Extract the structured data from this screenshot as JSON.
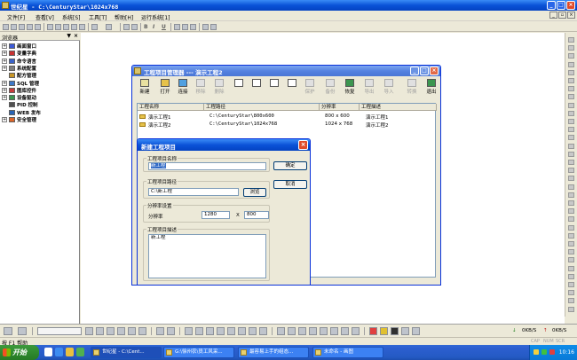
{
  "app": {
    "title": "世纪星 - C:\\CenturyStar\\1024x768"
  },
  "menu": [
    "文件[F]",
    "查看[V]",
    "系统[S]",
    "工具[T]",
    "帮助[H]",
    "运行系统[1]"
  ],
  "toolbar": {
    "font_b": "B",
    "font_i": "I",
    "font_u": "U"
  },
  "browser": {
    "title": "浏览器",
    "pin": "▼",
    "close": "×",
    "items": [
      {
        "expander": "+",
        "label": "画面窗口",
        "color": "#3c5ad8"
      },
      {
        "expander": "+",
        "label": "变量字典",
        "color": "#c83232"
      },
      {
        "expander": "+",
        "label": "命令语言",
        "color": "#3c64c8"
      },
      {
        "expander": "+",
        "label": "系统配置",
        "color": "#808080"
      },
      {
        "expander": "",
        "label": "配方管理",
        "color": "#c89628"
      },
      {
        "expander": "+",
        "label": "SQL 管理",
        "color": "#3c78c8"
      },
      {
        "expander": "+",
        "label": "图库控件",
        "color": "#c83c3c"
      },
      {
        "expander": "+",
        "label": "设备驱动",
        "color": "#3c9650"
      },
      {
        "expander": "",
        "label": "PID 控制",
        "color": "#505050"
      },
      {
        "expander": "",
        "label": "WEB 发布",
        "color": "#2864b4"
      },
      {
        "expander": "+",
        "label": "安全管理",
        "color": "#dc6428"
      }
    ]
  },
  "project_manager": {
    "title": "工程项目管理器 --- 演示工程2",
    "tools": [
      {
        "label": "新建",
        "enabled": true,
        "color": "#e8e0a0"
      },
      {
        "label": "打开",
        "enabled": true,
        "color": "#e6c24a"
      },
      {
        "label": "连接",
        "enabled": true,
        "color": "#50a0e0"
      },
      {
        "label": "移除",
        "enabled": false,
        "color": "#e0e0e0"
      },
      {
        "label": "删除",
        "enabled": false,
        "color": "#e0e0e0"
      },
      {
        "label": "",
        "enabled": true,
        "color": "#ffffff"
      },
      {
        "label": "",
        "enabled": true,
        "color": "#ffffff"
      },
      {
        "label": "",
        "enabled": true,
        "color": "#ffffff"
      },
      {
        "label": "",
        "enabled": true,
        "color": "#ffffff"
      },
      {
        "label": "保护",
        "enabled": false,
        "color": "#e0e0e0"
      },
      {
        "label": "备份",
        "enabled": false,
        "color": "#e0e0e0"
      },
      {
        "label": "恢复",
        "enabled": true,
        "color": "#3c9650"
      },
      {
        "label": "导出",
        "enabled": false,
        "color": "#e0e0e0"
      },
      {
        "label": "导入",
        "enabled": false,
        "color": "#e0e0e0"
      },
      {
        "label": "转换",
        "enabled": false,
        "color": "#e0e0e0"
      },
      {
        "label": "退出",
        "enabled": true,
        "color": "#3c9650"
      }
    ],
    "columns": [
      "工程名称",
      "工程路径",
      "分辨率",
      "工程描述"
    ],
    "rows": [
      {
        "name": "演示工程1",
        "path": "C:\\CenturyStar\\800x600",
        "res": "800 x 600",
        "desc": "演示工程1"
      },
      {
        "name": "演示工程2",
        "path": "C:\\CenturyStar\\1024x768",
        "res": "1024 x 768",
        "desc": "演示工程2"
      }
    ]
  },
  "new_project_dialog": {
    "title": "新建工程项目",
    "close": "×",
    "name_group": "工程项目名称",
    "name_value": "新工程",
    "path_group": "工程项目路径",
    "path_value": "C:\\新工程",
    "browse": "浏览",
    "ok": "确定",
    "cancel": "取消",
    "res_group": "分辨率设置",
    "res_label": "分辨率",
    "res_w": "1280",
    "res_x": "X",
    "res_h": "800",
    "desc_group": "工程项目描述",
    "desc_value": "新工程"
  },
  "status": {
    "text": "按 F1 帮助",
    "net_left": "0KB/S",
    "net_right": "0KB/S",
    "indicators": [
      "CAP",
      "NUM",
      "SCR"
    ]
  },
  "taskbar": {
    "start": "开始",
    "tasks": [
      {
        "label": "世纪星 - C:\\Cent...",
        "active": true
      },
      {
        "label": "G:\\徐州农\\员工风采...",
        "active": false
      },
      {
        "label": "最容易上手的组态...",
        "active": false
      },
      {
        "label": "未命名 - 画图",
        "active": false
      }
    ],
    "clock": "10:16"
  },
  "colors": {
    "xp_blue": "#0a52d8",
    "inactive_caption": "#5582e0",
    "close_red": "#e04a28",
    "selection": "#316ac5"
  }
}
